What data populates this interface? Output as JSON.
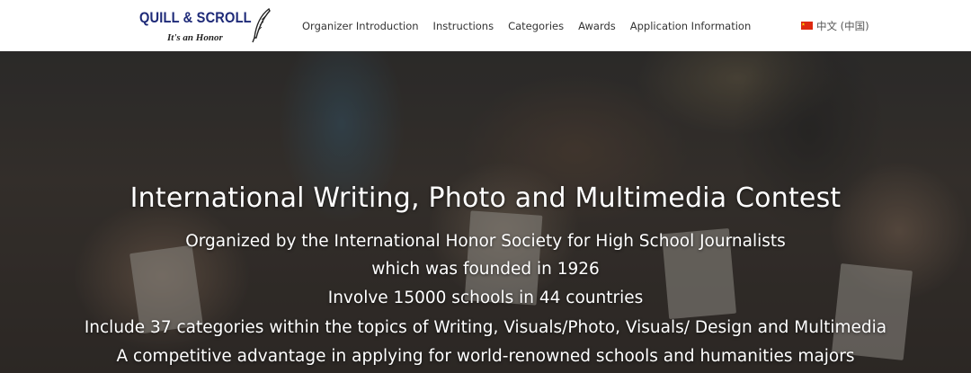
{
  "header": {
    "logo": {
      "title": "QUILL & SCROLL",
      "tagline": "It's an Honor"
    },
    "nav": [
      {
        "label": "Organizer Introduction"
      },
      {
        "label": "Instructions"
      },
      {
        "label": "Categories"
      },
      {
        "label": "Awards"
      },
      {
        "label": "Application Information"
      }
    ],
    "language": {
      "label": "中文 (中国)",
      "flag": "china-flag-icon"
    }
  },
  "hero": {
    "title": "International Writing, Photo and Multimedia Contest",
    "lines": [
      "Organized by the International Honor Society for High School Journalists",
      "which was founded in 1926",
      "Involve 15000 schools in 44 countries",
      "Include 37 categories within the topics of Writing, Visuals/Photo, Visuals/ Design and Multimedia",
      "A competitive advantage in applying for world-renowned schools and humanities majors"
    ]
  },
  "colors": {
    "brand": "#1e2a78",
    "nav_text": "#333333",
    "hero_text": "#ffffff"
  }
}
